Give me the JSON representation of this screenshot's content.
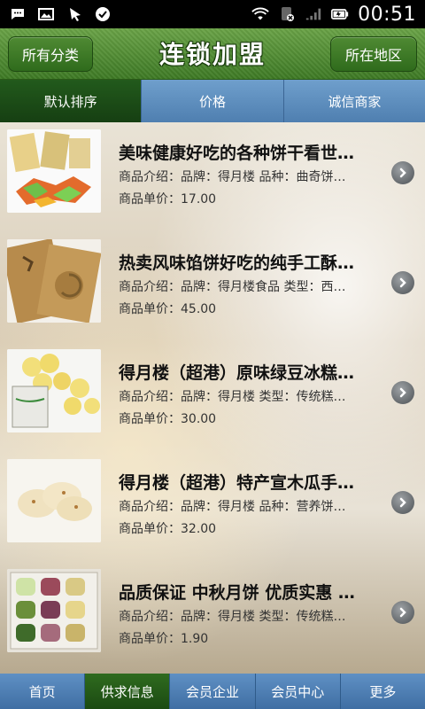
{
  "status_bar": {
    "time": "00:51",
    "icons": [
      "message-icon",
      "image-icon",
      "download-icon",
      "check-circle-icon",
      "wifi-icon",
      "sim-x-icon",
      "signal-icon",
      "battery-icon"
    ]
  },
  "header": {
    "left_button": "所有分类",
    "title": "连锁加盟",
    "right_button": "所在地区"
  },
  "tabs": [
    {
      "label": "默认排序",
      "active": true
    },
    {
      "label": "价格",
      "active": false
    },
    {
      "label": "诚信商家",
      "active": false
    }
  ],
  "items": [
    {
      "title": "美味健康好吃的各种饼干看世…",
      "desc": "商品介绍：品牌：得月楼 品种：曲奇饼…",
      "price": "商品单价：17.00"
    },
    {
      "title": "热卖风味馅饼好吃的纯手工酥…",
      "desc": "商品介绍：品牌：得月楼食品 类型：西…",
      "price": "商品单价：45.00"
    },
    {
      "title": "得月楼（超港）原味绿豆冰糕…",
      "desc": "商品介绍：品牌：得月楼 类型：传统糕…",
      "price": "商品单价：30.00"
    },
    {
      "title": "得月楼（超港）特产宣木瓜手…",
      "desc": "商品介绍：品牌：得月楼 品种：营养饼…",
      "price": "商品单价：32.00"
    },
    {
      "title": "品质保证 中秋月饼 优质实惠 …",
      "desc": "商品介绍：品牌：得月楼 类型：传统糕…",
      "price": "商品单价：1.90"
    }
  ],
  "bottom_nav": [
    {
      "label": "首页",
      "active": false
    },
    {
      "label": "供求信息",
      "active": true
    },
    {
      "label": "会员企业",
      "active": false
    },
    {
      "label": "会员中心",
      "active": false
    },
    {
      "label": "更多",
      "active": false
    }
  ]
}
